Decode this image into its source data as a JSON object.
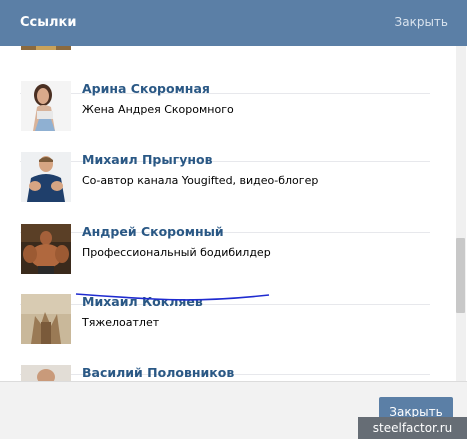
{
  "header": {
    "title": "Ссылки",
    "close_label": "Закрыть"
  },
  "links": [
    {
      "name": "",
      "description": ""
    },
    {
      "name": "Арина Скоромная",
      "description": "Жена Андрея Скоромного"
    },
    {
      "name": "Михаил Прыгунов",
      "description": "Со-автор канала Yougifted, видео-блогер"
    },
    {
      "name": "Андрей Скоромный",
      "description": "Профессиональный бодибилдер"
    },
    {
      "name": "Михаил Кокляев",
      "description": "Тяжелоатлет"
    },
    {
      "name": "Василий Половников",
      "description": ""
    }
  ],
  "footer": {
    "close_button": "Закрыть"
  },
  "watermark": "steelfactor.ru",
  "colors": {
    "header": "#5b7fa6",
    "link": "#2a5885",
    "annotation": "#1f2bd0"
  }
}
